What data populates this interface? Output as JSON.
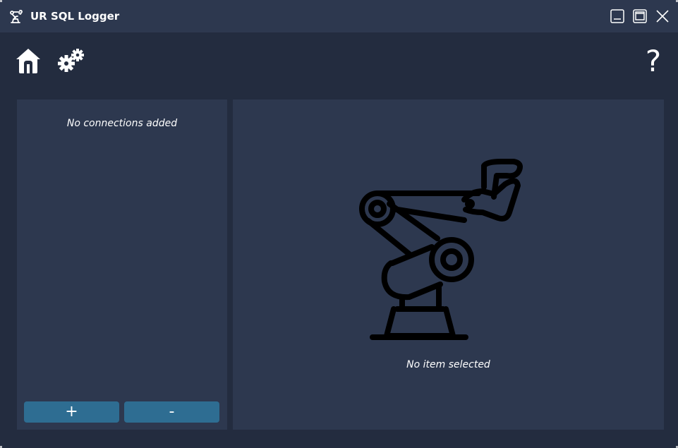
{
  "window": {
    "title": "UR SQL Logger"
  },
  "toolbar": {
    "help_label": "?"
  },
  "connections": {
    "empty_text": "No connections added",
    "add_label": "+",
    "remove_label": "-"
  },
  "detail": {
    "empty_text": "No item selected"
  },
  "colors": {
    "titlebar": "#2d384f",
    "background": "#232c3f",
    "panel": "#2d384f",
    "button": "#2e6d92"
  },
  "icons": [
    "robot-arm-icon",
    "minimize-icon",
    "maximize-icon",
    "close-icon",
    "home-icon",
    "gear-icon",
    "help-icon"
  ]
}
